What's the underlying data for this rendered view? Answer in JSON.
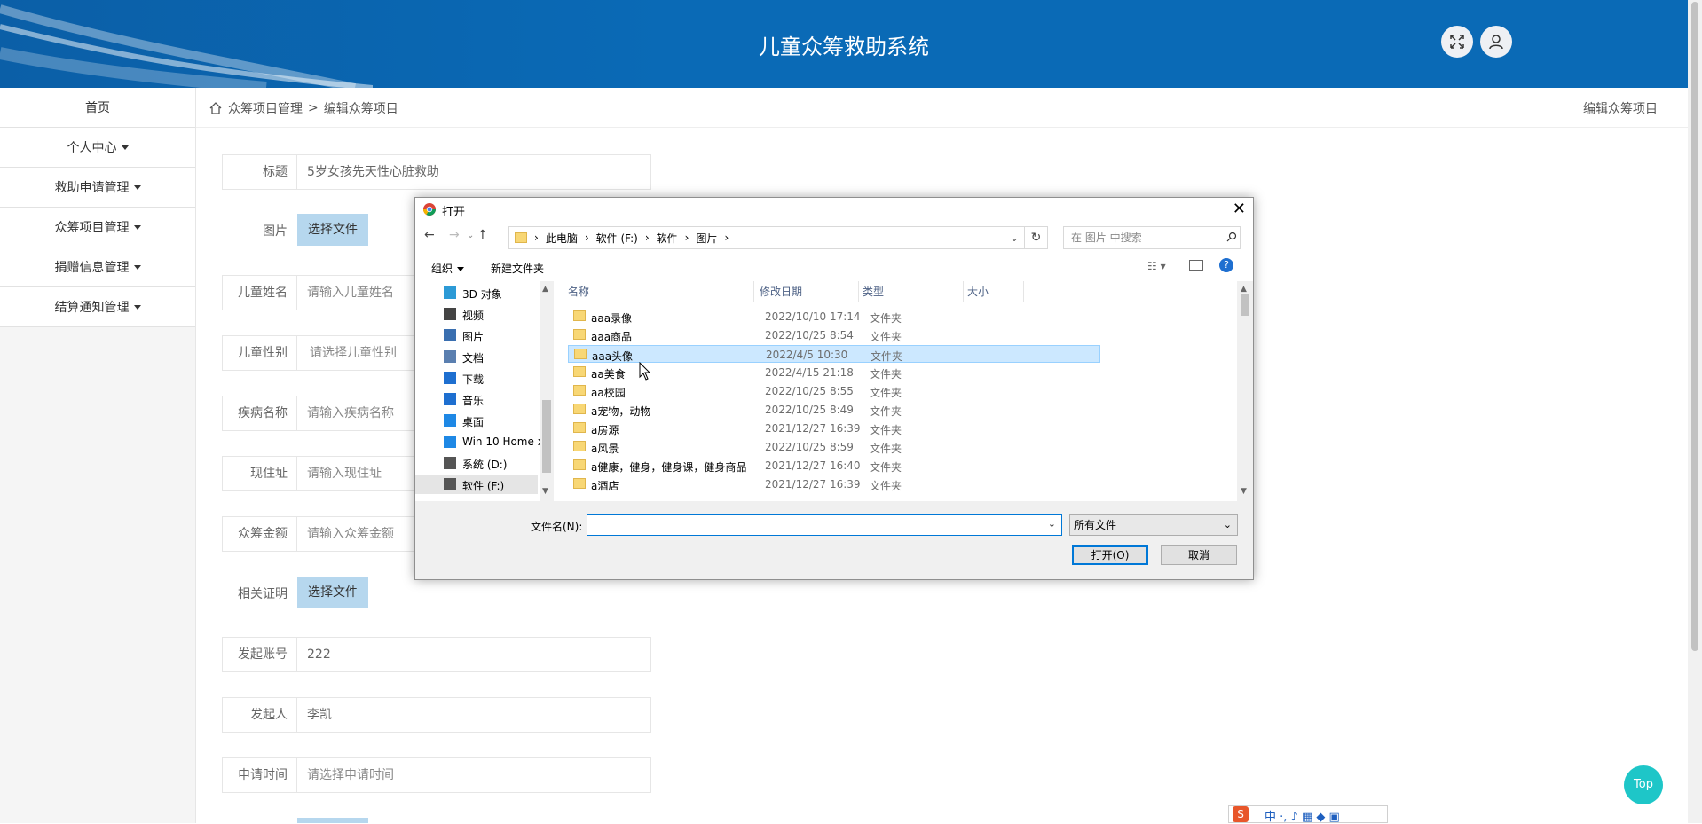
{
  "header": {
    "title": "儿童众筹救助系统"
  },
  "sidebar": {
    "items": [
      {
        "label": "首页"
      },
      {
        "label": "个人中心"
      },
      {
        "label": "救助申请管理"
      },
      {
        "label": "众筹项目管理"
      },
      {
        "label": "捐赠信息管理"
      },
      {
        "label": "结算通知管理"
      }
    ]
  },
  "breadcrumb": {
    "section": "众筹项目管理",
    "separator": ">",
    "page": "编辑众筹项目",
    "right": "编辑众筹项目"
  },
  "form": {
    "title": {
      "label": "标题",
      "value": "5岁女孩先天性心脏救助"
    },
    "image": {
      "label": "图片",
      "button": "选择文件"
    },
    "child_name": {
      "label": "儿童姓名",
      "placeholder": "请输入儿童姓名"
    },
    "child_gender": {
      "label": "儿童性别",
      "placeholder": "请选择儿童性别"
    },
    "disease": {
      "label": "疾病名称",
      "placeholder": "请输入疾病名称"
    },
    "address": {
      "label": "现住址",
      "placeholder": "请输入现住址"
    },
    "amount": {
      "label": "众筹金额",
      "placeholder": "请输入众筹金额"
    },
    "proof": {
      "label": "相关证明",
      "button": "选择文件"
    },
    "account": {
      "label": "发起账号",
      "value": "222"
    },
    "initiator": {
      "label": "发起人",
      "value": "李凯"
    },
    "apply_time": {
      "label": "申请时间",
      "placeholder": "请选择申请时间"
    }
  },
  "dialog": {
    "title": "打开",
    "path": [
      "此电脑",
      "软件 (F:)",
      "软件",
      "图片"
    ],
    "search_placeholder": "在 图片 中搜索",
    "organize": "组织",
    "new_folder": "新建文件夹",
    "nav_items": [
      {
        "label": "3D 对象",
        "icon": "cube-icon"
      },
      {
        "label": "视频",
        "icon": "video-icon"
      },
      {
        "label": "图片",
        "icon": "picture-icon"
      },
      {
        "label": "文档",
        "icon": "document-icon"
      },
      {
        "label": "下载",
        "icon": "download-icon"
      },
      {
        "label": "音乐",
        "icon": "music-icon"
      },
      {
        "label": "桌面",
        "icon": "desktop-icon"
      },
      {
        "label": "Win 10 Home x",
        "icon": "computer-icon"
      },
      {
        "label": "系统 (D:)",
        "icon": "drive-icon"
      },
      {
        "label": "软件 (F:)",
        "icon": "drive-icon"
      }
    ],
    "columns": [
      "名称",
      "修改日期",
      "类型",
      "大小"
    ],
    "files": [
      {
        "name": "aaa录像",
        "date": "2022/10/10 17:14",
        "type": "文件夹"
      },
      {
        "name": "aaa商品",
        "date": "2022/10/25 8:54",
        "type": "文件夹"
      },
      {
        "name": "aaa头像",
        "date": "2022/4/5 10:30",
        "type": "文件夹"
      },
      {
        "name": "aa美食",
        "date": "2022/4/15 21:18",
        "type": "文件夹"
      },
      {
        "name": "aa校园",
        "date": "2022/10/25 8:55",
        "type": "文件夹"
      },
      {
        "name": "a宠物，动物",
        "date": "2022/10/25 8:49",
        "type": "文件夹"
      },
      {
        "name": "a房源",
        "date": "2021/12/27 16:39",
        "type": "文件夹"
      },
      {
        "name": "a风景",
        "date": "2022/10/25 8:59",
        "type": "文件夹"
      },
      {
        "name": "a健康，健身，健身课，健身商品",
        "date": "2021/12/27 16:40",
        "type": "文件夹"
      },
      {
        "name": "a酒店",
        "date": "2021/12/27 16:39",
        "type": "文件夹"
      }
    ],
    "filename_label": "文件名(N):",
    "filename_value": "",
    "filetype": "所有文件",
    "open_button": "打开(O)",
    "cancel_button": "取消"
  },
  "top_button": "Top",
  "colors": {
    "header": "#0a6ab6",
    "button": "#b6d7ee",
    "top": "#1ec6c8"
  }
}
